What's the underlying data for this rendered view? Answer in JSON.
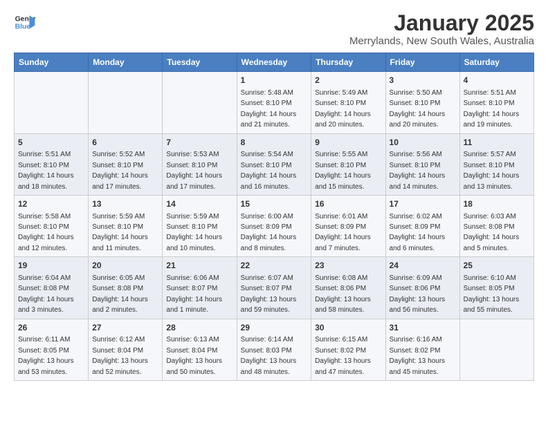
{
  "logo": {
    "line1": "General",
    "line2": "Blue"
  },
  "title": "January 2025",
  "subtitle": "Merrylands, New South Wales, Australia",
  "headers": [
    "Sunday",
    "Monday",
    "Tuesday",
    "Wednesday",
    "Thursday",
    "Friday",
    "Saturday"
  ],
  "weeks": [
    [
      {
        "day": "",
        "info": ""
      },
      {
        "day": "",
        "info": ""
      },
      {
        "day": "",
        "info": ""
      },
      {
        "day": "1",
        "info": "Sunrise: 5:48 AM\nSunset: 8:10 PM\nDaylight: 14 hours and 21 minutes."
      },
      {
        "day": "2",
        "info": "Sunrise: 5:49 AM\nSunset: 8:10 PM\nDaylight: 14 hours and 20 minutes."
      },
      {
        "day": "3",
        "info": "Sunrise: 5:50 AM\nSunset: 8:10 PM\nDaylight: 14 hours and 20 minutes."
      },
      {
        "day": "4",
        "info": "Sunrise: 5:51 AM\nSunset: 8:10 PM\nDaylight: 14 hours and 19 minutes."
      }
    ],
    [
      {
        "day": "5",
        "info": "Sunrise: 5:51 AM\nSunset: 8:10 PM\nDaylight: 14 hours and 18 minutes."
      },
      {
        "day": "6",
        "info": "Sunrise: 5:52 AM\nSunset: 8:10 PM\nDaylight: 14 hours and 17 minutes."
      },
      {
        "day": "7",
        "info": "Sunrise: 5:53 AM\nSunset: 8:10 PM\nDaylight: 14 hours and 17 minutes."
      },
      {
        "day": "8",
        "info": "Sunrise: 5:54 AM\nSunset: 8:10 PM\nDaylight: 14 hours and 16 minutes."
      },
      {
        "day": "9",
        "info": "Sunrise: 5:55 AM\nSunset: 8:10 PM\nDaylight: 14 hours and 15 minutes."
      },
      {
        "day": "10",
        "info": "Sunrise: 5:56 AM\nSunset: 8:10 PM\nDaylight: 14 hours and 14 minutes."
      },
      {
        "day": "11",
        "info": "Sunrise: 5:57 AM\nSunset: 8:10 PM\nDaylight: 14 hours and 13 minutes."
      }
    ],
    [
      {
        "day": "12",
        "info": "Sunrise: 5:58 AM\nSunset: 8:10 PM\nDaylight: 14 hours and 12 minutes."
      },
      {
        "day": "13",
        "info": "Sunrise: 5:59 AM\nSunset: 8:10 PM\nDaylight: 14 hours and 11 minutes."
      },
      {
        "day": "14",
        "info": "Sunrise: 5:59 AM\nSunset: 8:10 PM\nDaylight: 14 hours and 10 minutes."
      },
      {
        "day": "15",
        "info": "Sunrise: 6:00 AM\nSunset: 8:09 PM\nDaylight: 14 hours and 8 minutes."
      },
      {
        "day": "16",
        "info": "Sunrise: 6:01 AM\nSunset: 8:09 PM\nDaylight: 14 hours and 7 minutes."
      },
      {
        "day": "17",
        "info": "Sunrise: 6:02 AM\nSunset: 8:09 PM\nDaylight: 14 hours and 6 minutes."
      },
      {
        "day": "18",
        "info": "Sunrise: 6:03 AM\nSunset: 8:08 PM\nDaylight: 14 hours and 5 minutes."
      }
    ],
    [
      {
        "day": "19",
        "info": "Sunrise: 6:04 AM\nSunset: 8:08 PM\nDaylight: 14 hours and 3 minutes."
      },
      {
        "day": "20",
        "info": "Sunrise: 6:05 AM\nSunset: 8:08 PM\nDaylight: 14 hours and 2 minutes."
      },
      {
        "day": "21",
        "info": "Sunrise: 6:06 AM\nSunset: 8:07 PM\nDaylight: 14 hours and 1 minute."
      },
      {
        "day": "22",
        "info": "Sunrise: 6:07 AM\nSunset: 8:07 PM\nDaylight: 13 hours and 59 minutes."
      },
      {
        "day": "23",
        "info": "Sunrise: 6:08 AM\nSunset: 8:06 PM\nDaylight: 13 hours and 58 minutes."
      },
      {
        "day": "24",
        "info": "Sunrise: 6:09 AM\nSunset: 8:06 PM\nDaylight: 13 hours and 56 minutes."
      },
      {
        "day": "25",
        "info": "Sunrise: 6:10 AM\nSunset: 8:05 PM\nDaylight: 13 hours and 55 minutes."
      }
    ],
    [
      {
        "day": "26",
        "info": "Sunrise: 6:11 AM\nSunset: 8:05 PM\nDaylight: 13 hours and 53 minutes."
      },
      {
        "day": "27",
        "info": "Sunrise: 6:12 AM\nSunset: 8:04 PM\nDaylight: 13 hours and 52 minutes."
      },
      {
        "day": "28",
        "info": "Sunrise: 6:13 AM\nSunset: 8:04 PM\nDaylight: 13 hours and 50 minutes."
      },
      {
        "day": "29",
        "info": "Sunrise: 6:14 AM\nSunset: 8:03 PM\nDaylight: 13 hours and 48 minutes."
      },
      {
        "day": "30",
        "info": "Sunrise: 6:15 AM\nSunset: 8:02 PM\nDaylight: 13 hours and 47 minutes."
      },
      {
        "day": "31",
        "info": "Sunrise: 6:16 AM\nSunset: 8:02 PM\nDaylight: 13 hours and 45 minutes."
      },
      {
        "day": "",
        "info": ""
      }
    ]
  ]
}
